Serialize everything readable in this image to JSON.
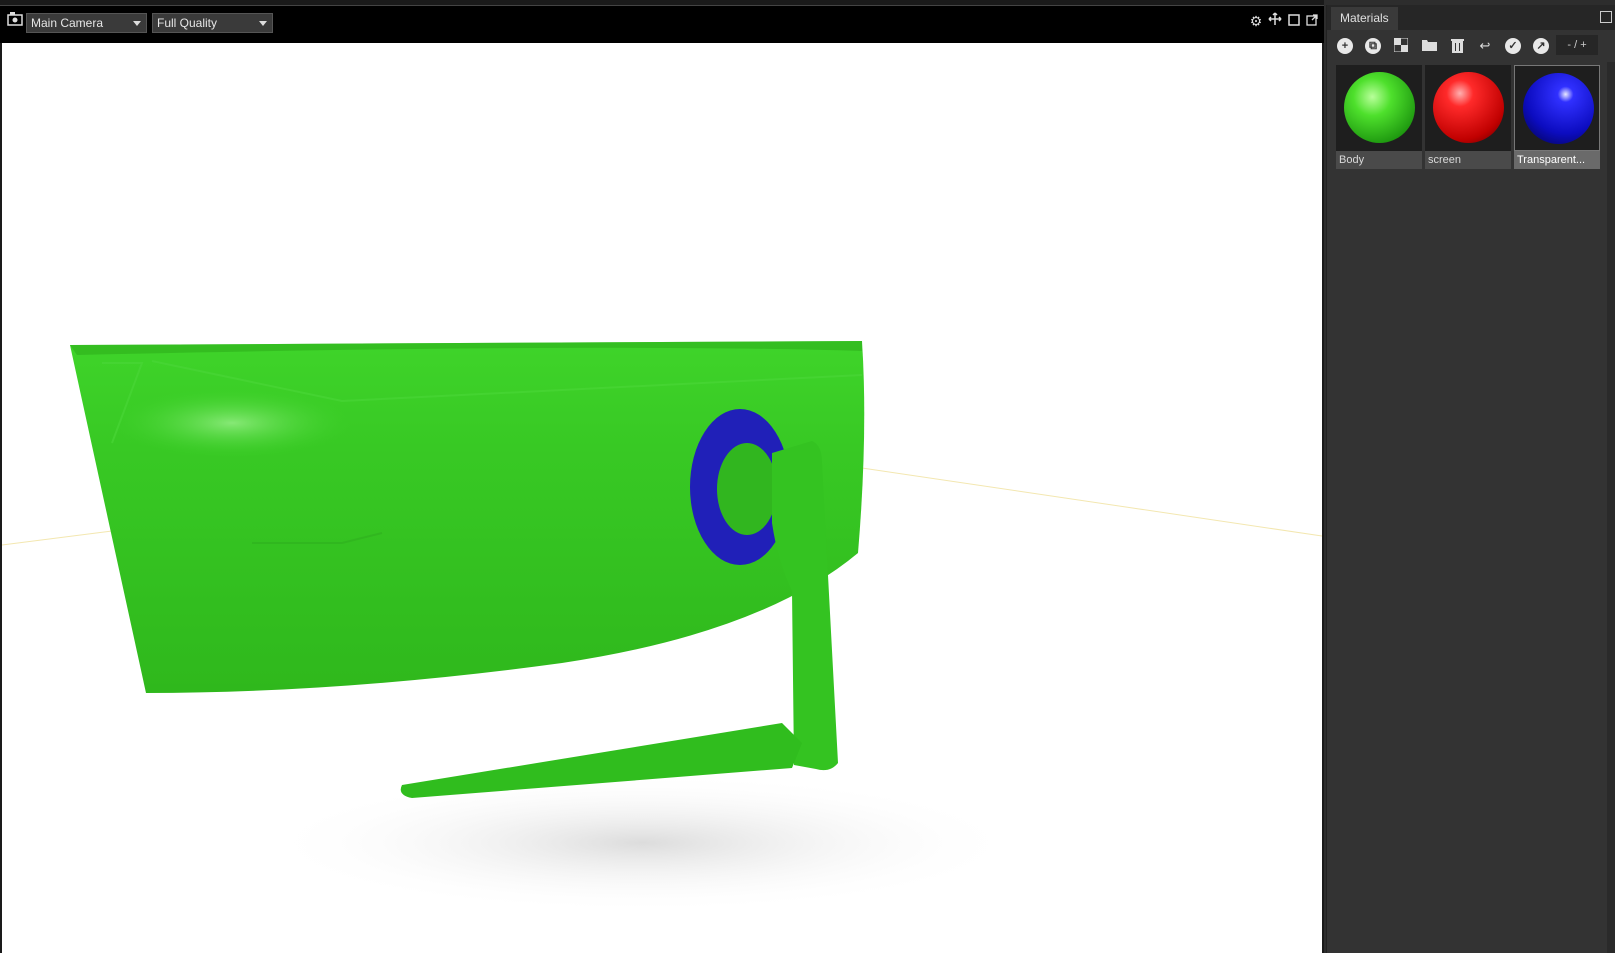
{
  "viewport": {
    "camera_label": "Main Camera",
    "quality_label": "Full Quality",
    "icons": [
      "camera-icon",
      "gear-icon",
      "move-icon",
      "square-icon",
      "popout-icon"
    ]
  },
  "materials": {
    "tab_label": "Materials",
    "counter": "- / +",
    "toolbar_icons": [
      "add-icon",
      "duplicate-icon",
      "checker-icon",
      "folder-icon",
      "trash-icon",
      "share-icon",
      "check-circle-icon",
      "arrow-circle-icon"
    ],
    "items": [
      {
        "label": "Body",
        "color": "#33cc22"
      },
      {
        "label": "screen",
        "color": "#dd1111"
      },
      {
        "label": "Transparent...",
        "color": "#1111cc",
        "selected": true
      }
    ]
  },
  "scene": {
    "body_color": "#33c41f",
    "ring_color": "#2222bb",
    "background": "#ffffff"
  }
}
